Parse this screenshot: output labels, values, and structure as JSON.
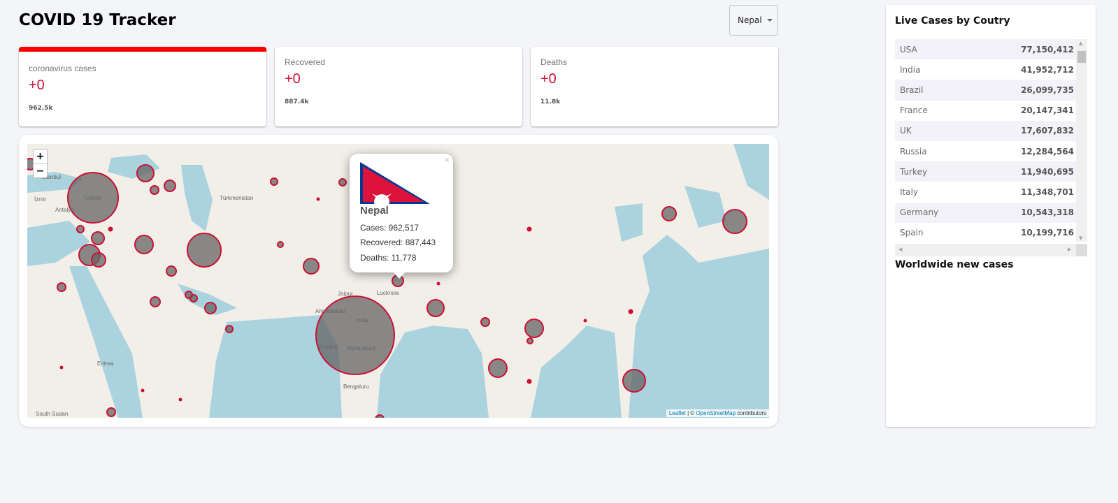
{
  "header": {
    "title": "COVID 19 Tracker",
    "country_select": "Nepal"
  },
  "cards": [
    {
      "label": "coronavirus cases",
      "new": "+0",
      "total": "962.5k",
      "selected": true
    },
    {
      "label": "Recovered",
      "new": "+0",
      "total": "887.4k"
    },
    {
      "label": "Deaths",
      "new": "+0",
      "total": "11.8k"
    }
  ],
  "colors": {
    "accent": "#cc1034",
    "selected_bar": "#ff0000",
    "water": "#aad3df",
    "land": "#f2efe9"
  },
  "map": {
    "zoom_in": "+",
    "zoom_out": "−",
    "labels": {
      "india": "India",
      "mumbai": "Mumbai",
      "hyderabad": "Hyderabad",
      "bengaluru": "Bengaluru",
      "lucknow": "Lucknow",
      "ahmedabad": "Ahmedabad",
      "jaipur": "Jaipur",
      "turkiye": "Türkiye",
      "istanbul": "Istanbul",
      "south_sudan": "South Sudan",
      "eritrea": "Eritrea",
      "turkmenistan": "Türkmenistan",
      "izmir": "İzmir",
      "antalya": "Antalya"
    },
    "attribution": {
      "leaflet": "Leaflet",
      "sep": " | © ",
      "osm": "OpenStreetMap",
      "contrib": " contributors"
    },
    "popup": {
      "country": "Nepal",
      "cases": "Cases: 962,517",
      "recovered": "Recovered: 887,443",
      "deaths": "Deaths: 11,778",
      "close": "×",
      "flag_icon": "nepal-flag"
    }
  },
  "sidebar": {
    "title": "Live Cases by Coutry",
    "rows": [
      {
        "country": "USA",
        "cases": "77,150,412"
      },
      {
        "country": "India",
        "cases": "41,952,712"
      },
      {
        "country": "Brazil",
        "cases": "26,099,735"
      },
      {
        "country": "France",
        "cases": "20,147,341"
      },
      {
        "country": "UK",
        "cases": "17,607,832"
      },
      {
        "country": "Russia",
        "cases": "12,284,564"
      },
      {
        "country": "Turkey",
        "cases": "11,940,695"
      },
      {
        "country": "Italy",
        "cases": "11,348,701"
      },
      {
        "country": "Germany",
        "cases": "10,543,318"
      },
      {
        "country": "Spain",
        "cases": "10,199,716"
      }
    ],
    "chart_title": "Worldwide new cases"
  }
}
